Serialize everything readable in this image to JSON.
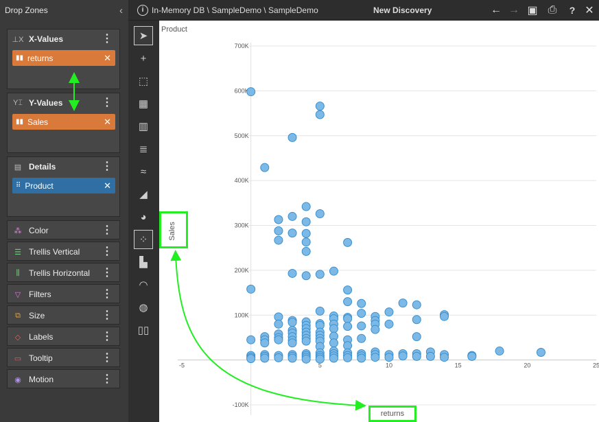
{
  "drop_zones": {
    "title": "Drop Zones",
    "x_values": {
      "label": "X-Values",
      "chip": "returns"
    },
    "y_values": {
      "label": "Y-Values",
      "chip": "Sales"
    },
    "details": {
      "label": "Details",
      "chip": "Product"
    },
    "small_zones": [
      "Color",
      "Trellis Vertical",
      "Trellis Horizontal",
      "Filters",
      "Size",
      "Labels",
      "Tooltip",
      "Motion"
    ]
  },
  "topbar": {
    "breadcrumb": "In-Memory DB \\ SampleDemo \\ SampleDemo",
    "title": "New Discovery"
  },
  "chart_data": {
    "type": "scatter",
    "title": "Product",
    "xlabel": "returns",
    "ylabel": "Sales",
    "xlim": [
      -5,
      25
    ],
    "ylim": [
      -100000,
      700000
    ],
    "x_ticks": [
      "-5",
      "5",
      "10",
      "15",
      "20",
      "25"
    ],
    "y_ticks": [
      "700K",
      "600K",
      "500K",
      "400K",
      "300K",
      "200K",
      "100K",
      "-100K"
    ],
    "points": [
      [
        0,
        598000
      ],
      [
        1,
        429000
      ],
      [
        3,
        496000
      ],
      [
        5,
        566000
      ],
      [
        5,
        547000
      ],
      [
        2,
        313000
      ],
      [
        2,
        288000
      ],
      [
        2,
        267000
      ],
      [
        3,
        320000
      ],
      [
        3,
        283000
      ],
      [
        4,
        342000
      ],
      [
        4,
        308000
      ],
      [
        4,
        282000
      ],
      [
        4,
        263000
      ],
      [
        4,
        242000
      ],
      [
        5,
        326000
      ],
      [
        7,
        262000
      ],
      [
        3,
        193000
      ],
      [
        4,
        188000
      ],
      [
        5,
        191000
      ],
      [
        6,
        198000
      ],
      [
        0,
        158000
      ],
      [
        7,
        156000
      ],
      [
        7,
        130000
      ],
      [
        8,
        126000
      ],
      [
        8,
        104000
      ],
      [
        9,
        97000
      ],
      [
        10,
        107000
      ],
      [
        11,
        127000
      ],
      [
        12,
        123000
      ],
      [
        12,
        90000
      ],
      [
        14,
        101000
      ],
      [
        14,
        97000
      ],
      [
        5,
        109000
      ],
      [
        6,
        98000
      ],
      [
        6,
        92000
      ],
      [
        7,
        95000
      ],
      [
        7,
        92000
      ],
      [
        2,
        96000
      ],
      [
        2,
        80000
      ],
      [
        3,
        88000
      ],
      [
        3,
        84000
      ],
      [
        4,
        85000
      ],
      [
        4,
        77000
      ],
      [
        5,
        81000
      ],
      [
        5,
        77000
      ],
      [
        6,
        80000
      ],
      [
        6,
        70000
      ],
      [
        7,
        75000
      ],
      [
        8,
        76000
      ],
      [
        9,
        88000
      ],
      [
        9,
        80000
      ],
      [
        9,
        68000
      ],
      [
        10,
        80000
      ],
      [
        12,
        52000
      ],
      [
        8,
        48000
      ],
      [
        7,
        45000
      ],
      [
        0,
        45000
      ],
      [
        1,
        52000
      ],
      [
        1,
        45000
      ],
      [
        1,
        38000
      ],
      [
        2,
        58000
      ],
      [
        2,
        50000
      ],
      [
        2,
        45000
      ],
      [
        3,
        66000
      ],
      [
        3,
        60000
      ],
      [
        3,
        52000
      ],
      [
        3,
        44000
      ],
      [
        3,
        38000
      ],
      [
        4,
        70000
      ],
      [
        4,
        62000
      ],
      [
        4,
        55000
      ],
      [
        4,
        48000
      ],
      [
        4,
        42000
      ],
      [
        5,
        62000
      ],
      [
        5,
        55000
      ],
      [
        5,
        48000
      ],
      [
        5,
        42000
      ],
      [
        5,
        30000
      ],
      [
        6,
        53000
      ],
      [
        6,
        38000
      ],
      [
        7,
        32000
      ],
      [
        0,
        10000
      ],
      [
        0,
        6000
      ],
      [
        0,
        3000
      ],
      [
        1,
        12000
      ],
      [
        1,
        8000
      ],
      [
        1,
        4000
      ],
      [
        2,
        10000
      ],
      [
        2,
        5000
      ],
      [
        3,
        12000
      ],
      [
        3,
        8000
      ],
      [
        3,
        4000
      ],
      [
        4,
        14000
      ],
      [
        4,
        10000
      ],
      [
        4,
        6000
      ],
      [
        4,
        2000
      ],
      [
        5,
        16000
      ],
      [
        5,
        10000
      ],
      [
        5,
        6000
      ],
      [
        5,
        2000
      ],
      [
        6,
        20000
      ],
      [
        6,
        14000
      ],
      [
        6,
        9000
      ],
      [
        6,
        4000
      ],
      [
        7,
        16000
      ],
      [
        7,
        10000
      ],
      [
        7,
        5000
      ],
      [
        8,
        14000
      ],
      [
        8,
        9000
      ],
      [
        8,
        4000
      ],
      [
        9,
        18000
      ],
      [
        9,
        12000
      ],
      [
        9,
        6000
      ],
      [
        10,
        12000
      ],
      [
        10,
        6000
      ],
      [
        11,
        14000
      ],
      [
        11,
        9000
      ],
      [
        12,
        14000
      ],
      [
        12,
        8000
      ],
      [
        13,
        18000
      ],
      [
        13,
        8000
      ],
      [
        14,
        12000
      ],
      [
        14,
        6000
      ],
      [
        16,
        10000
      ],
      [
        16,
        8000
      ],
      [
        18,
        20000
      ],
      [
        21,
        17000
      ]
    ],
    "grid": true
  }
}
